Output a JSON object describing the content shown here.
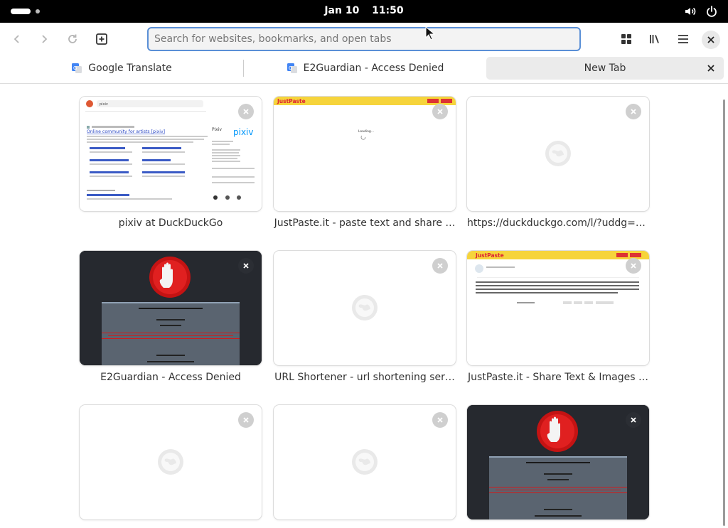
{
  "topbar": {
    "date": "Jan 10",
    "time": "11:50"
  },
  "toolbar": {
    "search_placeholder": "Search for websites, bookmarks, and open tabs"
  },
  "tabs": [
    {
      "label": "Google Translate",
      "active": false
    },
    {
      "label": "E2Guardian - Access Denied",
      "active": false
    },
    {
      "label": "New Tab",
      "active": true
    }
  ],
  "tiles": [
    {
      "caption": "pixiv at DuckDuckGo",
      "kind": "ddg"
    },
    {
      "caption": "JustPaste.it - paste text and share …",
      "kind": "justpaste-loading"
    },
    {
      "caption": "https://duckduckgo.com/l/?uddg=h…",
      "kind": "blank"
    },
    {
      "caption": "E2Guardian - Access Denied",
      "kind": "e2guardian"
    },
    {
      "caption": "URL Shortener - url shortening ser…",
      "kind": "blank"
    },
    {
      "caption": "JustPaste.it - Share Text & Images …",
      "kind": "justpaste-text"
    },
    {
      "caption": "",
      "kind": "blank"
    },
    {
      "caption": "",
      "kind": "blank"
    },
    {
      "caption": "",
      "kind": "e2guardian"
    }
  ],
  "thumb_text": {
    "ddg_query": "pixiv",
    "ddg_result_title": "Online community for artists [pixiv]",
    "ddg_side_brand": "pixiv",
    "ddg_side_title": "Pixiv",
    "jp_logo": "JustPaste",
    "jp_loading": "Loading..."
  },
  "colors": {
    "accent": "#5a8fd6",
    "justpaste_yellow": "#f6d43b",
    "e2_dark": "#26292f",
    "e2_red": "#d31a1a"
  }
}
